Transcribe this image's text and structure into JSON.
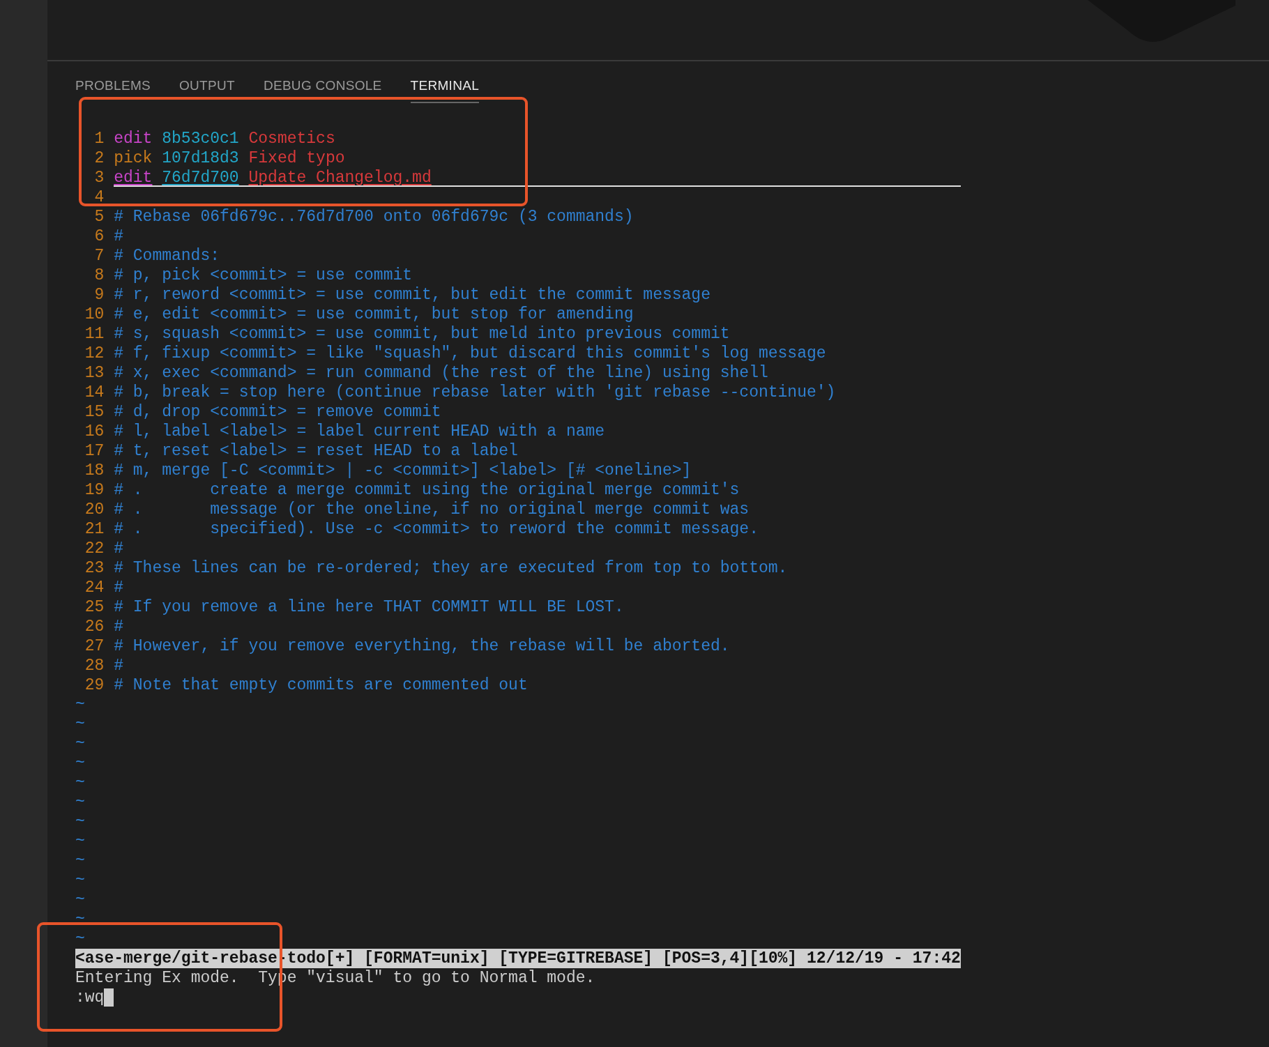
{
  "tabs": [
    {
      "label": "PROBLEMS",
      "selected": false
    },
    {
      "label": "OUTPUT",
      "selected": false
    },
    {
      "label": "DEBUG CONSOLE",
      "selected": false
    },
    {
      "label": "TERMINAL",
      "selected": true
    }
  ],
  "editor": {
    "lines": [
      {
        "number": "1",
        "current": false,
        "segments": [
          {
            "kind": "edit",
            "text": "edit"
          },
          {
            "kind": "hash",
            "text": "8b53c0c1"
          },
          {
            "kind": "subject",
            "text": "Cosmetics"
          }
        ]
      },
      {
        "number": "2",
        "current": false,
        "segments": [
          {
            "kind": "pick",
            "text": "pick"
          },
          {
            "kind": "hash",
            "text": "107d18d3"
          },
          {
            "kind": "subject",
            "text": "Fixed typo"
          }
        ]
      },
      {
        "number": "3",
        "current": true,
        "segments": [
          {
            "kind": "edit",
            "text": "edit"
          },
          {
            "kind": "hash",
            "text": "76d7d700"
          },
          {
            "kind": "subject",
            "text": "Update Changelog.md"
          }
        ]
      },
      {
        "number": "4",
        "current": false
      },
      {
        "number": "5",
        "current": false,
        "segments": [
          {
            "kind": "comment",
            "text": "# Rebase 06fd679c..76d7d700 onto 06fd679c (3 commands)"
          }
        ]
      },
      {
        "number": "6",
        "current": false,
        "segments": [
          {
            "kind": "comment",
            "text": "#"
          }
        ]
      },
      {
        "number": "7",
        "current": false,
        "segments": [
          {
            "kind": "comment",
            "text": "# Commands:"
          }
        ]
      },
      {
        "number": "8",
        "current": false,
        "segments": [
          {
            "kind": "comment",
            "text": "# p, pick <commit> = use commit"
          }
        ]
      },
      {
        "number": "9",
        "current": false,
        "segments": [
          {
            "kind": "comment",
            "text": "# r, reword <commit> = use commit, but edit the commit message"
          }
        ]
      },
      {
        "number": "10",
        "current": false,
        "segments": [
          {
            "kind": "comment",
            "text": "# e, edit <commit> = use commit, but stop for amending"
          }
        ]
      },
      {
        "number": "11",
        "current": false,
        "segments": [
          {
            "kind": "comment",
            "text": "# s, squash <commit> = use commit, but meld into previous commit"
          }
        ]
      },
      {
        "number": "12",
        "current": false,
        "segments": [
          {
            "kind": "comment",
            "text": "# f, fixup <commit> = like \"squash\", but discard this commit's log message"
          }
        ]
      },
      {
        "number": "13",
        "current": false,
        "segments": [
          {
            "kind": "comment",
            "text": "# x, exec <command> = run command (the rest of the line) using shell"
          }
        ]
      },
      {
        "number": "14",
        "current": false,
        "segments": [
          {
            "kind": "comment",
            "text": "# b, break = stop here (continue rebase later with 'git rebase --continue')"
          }
        ]
      },
      {
        "number": "15",
        "current": false,
        "segments": [
          {
            "kind": "comment",
            "text": "# d, drop <commit> = remove commit"
          }
        ]
      },
      {
        "number": "16",
        "current": false,
        "segments": [
          {
            "kind": "comment",
            "text": "# l, label <label> = label current HEAD with a name"
          }
        ]
      },
      {
        "number": "17",
        "current": false,
        "segments": [
          {
            "kind": "comment",
            "text": "# t, reset <label> = reset HEAD to a label"
          }
        ]
      },
      {
        "number": "18",
        "current": false,
        "segments": [
          {
            "kind": "comment",
            "text": "# m, merge [-C <commit> | -c <commit>] <label> [# <oneline>]"
          }
        ]
      },
      {
        "number": "19",
        "current": false,
        "segments": [
          {
            "kind": "comment",
            "text": "# .       create a merge commit using the original merge commit's"
          }
        ]
      },
      {
        "number": "20",
        "current": false,
        "segments": [
          {
            "kind": "comment",
            "text": "# .       message (or the oneline, if no original merge commit was"
          }
        ]
      },
      {
        "number": "21",
        "current": false,
        "segments": [
          {
            "kind": "comment",
            "text": "# .       specified). Use -c <commit> to reword the commit message."
          }
        ]
      },
      {
        "number": "22",
        "current": false,
        "segments": [
          {
            "kind": "comment",
            "text": "#"
          }
        ]
      },
      {
        "number": "23",
        "current": false,
        "segments": [
          {
            "kind": "comment",
            "text": "# These lines can be re-ordered; they are executed from top to bottom."
          }
        ]
      },
      {
        "number": "24",
        "current": false,
        "segments": [
          {
            "kind": "comment",
            "text": "#"
          }
        ]
      },
      {
        "number": "25",
        "current": false,
        "segments": [
          {
            "kind": "comment",
            "text": "# If you remove a line here THAT COMMIT WILL BE LOST."
          }
        ]
      },
      {
        "number": "26",
        "current": false,
        "segments": [
          {
            "kind": "comment",
            "text": "#"
          }
        ]
      },
      {
        "number": "27",
        "current": false,
        "segments": [
          {
            "kind": "comment",
            "text": "# However, if you remove everything, the rebase will be aborted."
          }
        ]
      },
      {
        "number": "28",
        "current": false,
        "segments": [
          {
            "kind": "comment",
            "text": "#"
          }
        ]
      },
      {
        "number": "29",
        "current": false,
        "segments": [
          {
            "kind": "comment",
            "text": "# Note that empty commits are commented out"
          }
        ]
      }
    ],
    "tildes": [
      "~",
      "~",
      "~",
      "~",
      "~",
      "~",
      "~",
      "~",
      "~",
      "~",
      "~",
      "~",
      "~"
    ],
    "status_line": "<ase-merge/git-rebase-todo[+] [FORMAT=unix] [TYPE=GITREBASE] [POS=3,4][10%] 12/12/19 - 17:42",
    "message": "Entering Ex mode.  Type \"visual\" to go to Normal mode.",
    "command": ":wq"
  }
}
